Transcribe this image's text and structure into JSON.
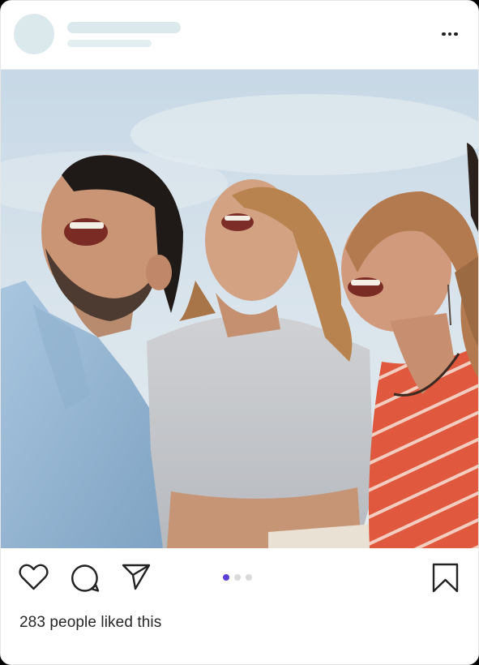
{
  "post": {
    "likes_text": "283 people liked this",
    "carousel": {
      "count": 3,
      "active_index": 0
    }
  },
  "colors": {
    "skeleton": "#dce9ec",
    "avatar": "#dce9ec",
    "dot_active": "#5b3fd6",
    "dot_inactive": "#d9d9d9",
    "icon": "#222222"
  },
  "icons": [
    "more-icon",
    "heart-icon",
    "comment-icon",
    "share-icon",
    "bookmark-icon"
  ]
}
